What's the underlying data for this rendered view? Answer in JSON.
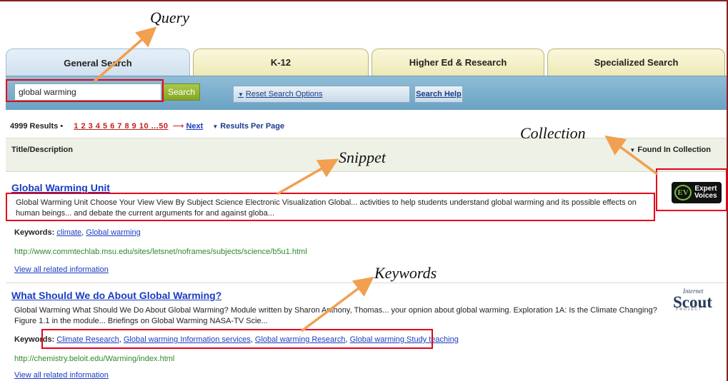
{
  "annotations": {
    "query": "Query",
    "collection": "Collection",
    "snippet": "Snippet",
    "keywords": "Keywords"
  },
  "tabs": [
    {
      "label": "General Search",
      "active": true
    },
    {
      "label": "K-12",
      "active": false
    },
    {
      "label": "Higher Ed & Research",
      "active": false
    },
    {
      "label": "Specialized Search",
      "active": false
    }
  ],
  "search": {
    "query_value": "global warming",
    "button_label": "Search",
    "reset_label": "Reset Search Options",
    "help_label": "Search Help"
  },
  "results_bar": {
    "count": "4999 Results",
    "bullet": "•",
    "pages_first": "1",
    "pages_rest": "2 3 4 5 6 7 8 9 10 ...50",
    "next": "Next",
    "per_page": "Results Per Page"
  },
  "columns": {
    "title": "Title/Description",
    "found_in": "Found In Collection"
  },
  "results": [
    {
      "title": "Global Warming Unit",
      "snippet": "Global Warming Unit Choose Your View View By Subject Science Electronic Visualization Global... activities to help students understand global warming and its possible effects on human beings... and debate the current arguments for and against globa...",
      "keywords_label": "Keywords:",
      "keywords": [
        "climate",
        "Global warming"
      ],
      "url": "http://www.commtechlab.msu.edu/sites/letsnet/noframes/subjects/science/b5u1.html",
      "related": "View all related information",
      "collection_badge": {
        "icon": "ev-logo",
        "letters": "EV",
        "line1": "Expert",
        "line2": "Voices"
      }
    },
    {
      "title": "What Should We do About Global Warming?",
      "snippet": "Global Warming  What Should We Do About Global Warming?   Module written by Sharon Anthony, Thomas... your opnion about global warming. Exploration 1A: Is the Climate Changing? Figure 1.1 in the module... Briefings on Global Warming NASA-TV Scie...",
      "keywords_label": "Keywords:",
      "keywords": [
        "Climate Research",
        "Global warming Information services",
        "Global warming Research",
        "Global warming Study teaching"
      ],
      "url": "http://chemistry.beloit.edu/Warming/index.html",
      "related": "View all related information",
      "collection_badge": {
        "icon": "internet-scout-logo",
        "small": "Internet",
        "big": "Scout",
        "sub": "PROJECT"
      }
    }
  ],
  "colors": {
    "annotation_red": "#e4001b",
    "arrow_orange": "#f0a050",
    "link_blue": "#1a3cc2",
    "url_green": "#2d8a2d",
    "search_green": "#84a624"
  }
}
